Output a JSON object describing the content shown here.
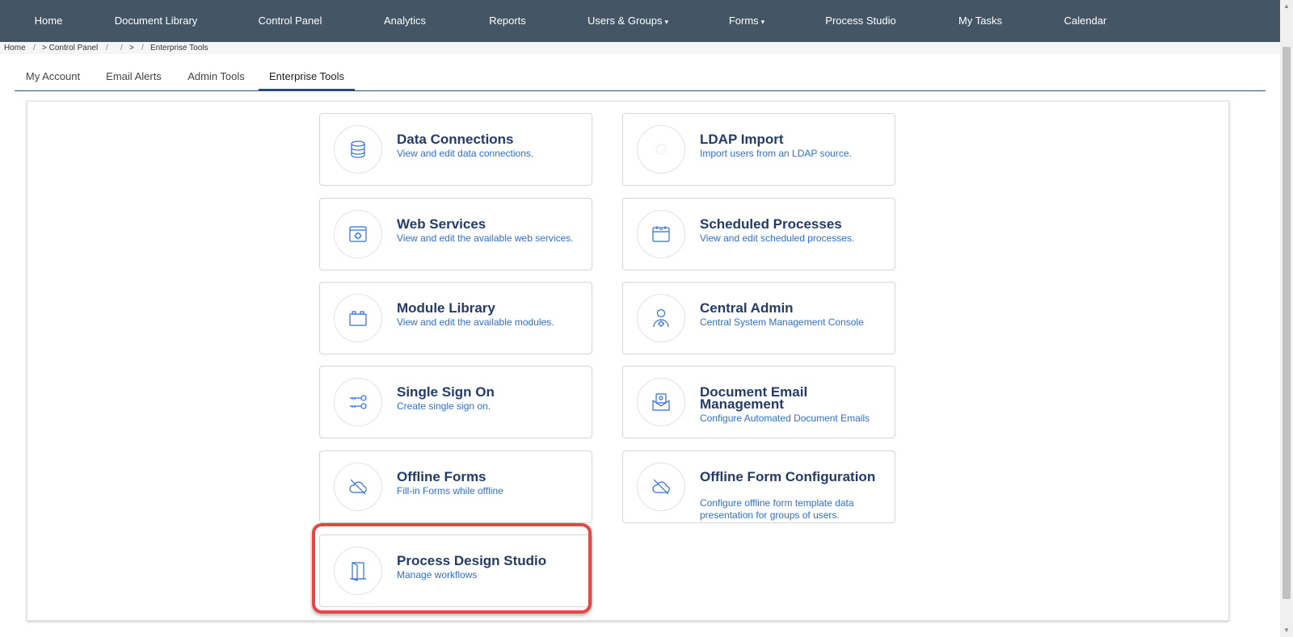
{
  "nav": {
    "items": [
      {
        "label": "Home"
      },
      {
        "label": "Document Library"
      },
      {
        "label": "Control Panel"
      },
      {
        "label": "Analytics"
      },
      {
        "label": "Reports"
      },
      {
        "label": "Users & Groups"
      },
      {
        "label": "Forms"
      },
      {
        "label": "Process Studio"
      },
      {
        "label": "My Tasks"
      },
      {
        "label": "Calendar"
      }
    ],
    "caret": "▾"
  },
  "breadcrumb": {
    "home": "Home",
    "sep": "/",
    "control_panel": "> Control Panel",
    "arrow": ">",
    "current": "Enterprise Tools"
  },
  "tabs": [
    {
      "label": "My Account"
    },
    {
      "label": "Email Alerts"
    },
    {
      "label": "Admin Tools"
    },
    {
      "label": "Enterprise Tools",
      "active": true
    }
  ],
  "cards": [
    {
      "title": "Data Connections",
      "desc": "View and edit data connections.",
      "icon": "database-icon"
    },
    {
      "title": "LDAP Import",
      "desc": "Import users from an LDAP source.",
      "icon": "ldap-icon"
    },
    {
      "title": "Web Services",
      "desc": "View and edit the available web services.",
      "icon": "web-services-icon"
    },
    {
      "title": "Scheduled Processes",
      "desc": "View and edit scheduled processes.",
      "icon": "calendar-icon"
    },
    {
      "title": "Module Library",
      "desc": "View and edit the available modules.",
      "icon": "module-icon"
    },
    {
      "title": "Central Admin",
      "desc": "Central System Management Console",
      "icon": "admin-user-gear-icon"
    },
    {
      "title": "Single Sign On",
      "desc": "Create single sign on.",
      "icon": "keys-icon"
    },
    {
      "title": "Document Email Management",
      "desc": "Configure Automated Document Emails",
      "icon": "email-document-icon"
    },
    {
      "title": "Offline Forms",
      "desc": "Fill-in Forms while offline",
      "icon": "cloud-off-icon"
    },
    {
      "title": "Offline Form Configuration",
      "desc": "Configure offline form template data presentation for groups of users.",
      "icon": "cloud-off-icon"
    },
    {
      "title": "Process Design Studio",
      "desc": "Manage workflows",
      "icon": "door-icon"
    }
  ],
  "colors": {
    "nav_bg": "#445566",
    "title": "#233b6a",
    "link": "#2f6ed8",
    "highlight": "#e84545"
  }
}
